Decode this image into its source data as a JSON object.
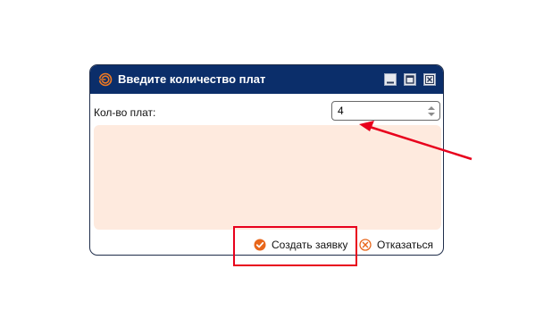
{
  "dialog": {
    "title": "Введите количество плат",
    "window_controls": {
      "minimize_icon": "minimize-icon",
      "maximize_icon": "maximize-icon",
      "close_icon": "close-icon"
    },
    "boards_label": "Кол-во плат:",
    "boards_value": "4",
    "create_label": "Создать заявку",
    "cancel_label": "Отказаться"
  },
  "colors": {
    "titlebar": "#0b2e6a",
    "accent_orange": "#e8661a",
    "content_area": "#feeade",
    "annotation_red": "#e8001c"
  }
}
